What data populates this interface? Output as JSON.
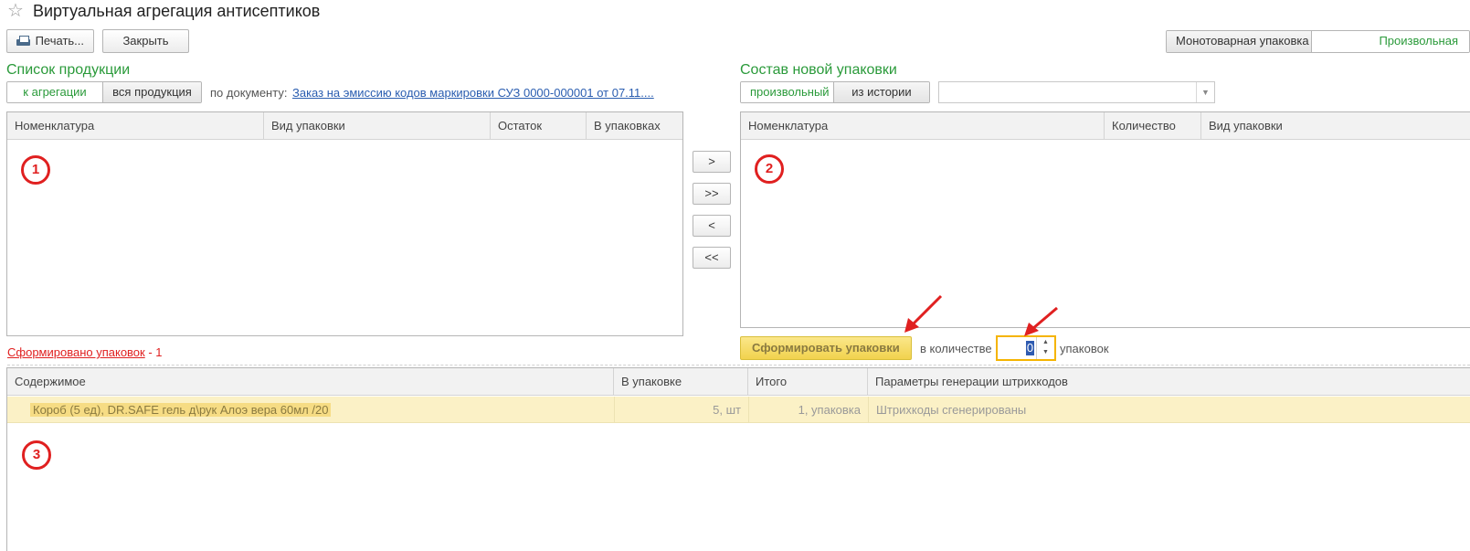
{
  "window": {
    "title": "Виртуальная агрегация антисептиков"
  },
  "toolbar": {
    "print_label": "Печать...",
    "close_label": "Закрыть",
    "pack_mode": {
      "options": [
        "Монотоварная упаковка",
        "Произвольная"
      ],
      "selected": "Произвольная"
    }
  },
  "left_panel": {
    "title": "Список продукции",
    "filter": {
      "options": [
        "к агрегации",
        "вся продукция"
      ],
      "selected": "к агрегации"
    },
    "doc_label": "по документу:",
    "doc_link": "Заказ на эмиссию кодов маркировки СУЗ 0000-000001 от 07.11....",
    "columns": [
      "Номенклатура",
      "Вид упаковки",
      "Остаток",
      "В упаковках"
    ],
    "rows": []
  },
  "move_buttons": [
    ">",
    ">>",
    "<",
    "<<"
  ],
  "right_panel": {
    "title": "Состав новой упаковки",
    "mode": {
      "options": [
        "произвольный",
        "из истории"
      ],
      "selected": "произвольный"
    },
    "history_select": "",
    "columns": [
      "Номенклатура",
      "Количество",
      "Вид упаковки"
    ],
    "rows": []
  },
  "form_pack": {
    "button_label": "Сформировать упаковки",
    "qty_prefix": "в количестве",
    "qty_value": "0",
    "qty_suffix": "упаковок"
  },
  "packs_summary": {
    "link": "Сформировано упаковок",
    "count": " - 1"
  },
  "packs_table": {
    "columns": [
      "Содержимое",
      "В упаковке",
      "Итого",
      "Параметры генерации штрихкодов"
    ],
    "rows": [
      {
        "content": "Короб (5 ед), DR.SAFE гель д\\рук Алоэ вера 60мл /20",
        "in_pack": "5, шт",
        "total": "1, упаковка",
        "params": "Штрихкоды сгенерированы"
      }
    ]
  },
  "annotations": {
    "marker1": "1",
    "marker2": "2",
    "marker3": "3"
  },
  "colors": {
    "accent_green": "#2a9a3a",
    "link_blue": "#2a5db0",
    "marker_red": "#e02020",
    "highlight_yellow": "#fbf1c6"
  }
}
